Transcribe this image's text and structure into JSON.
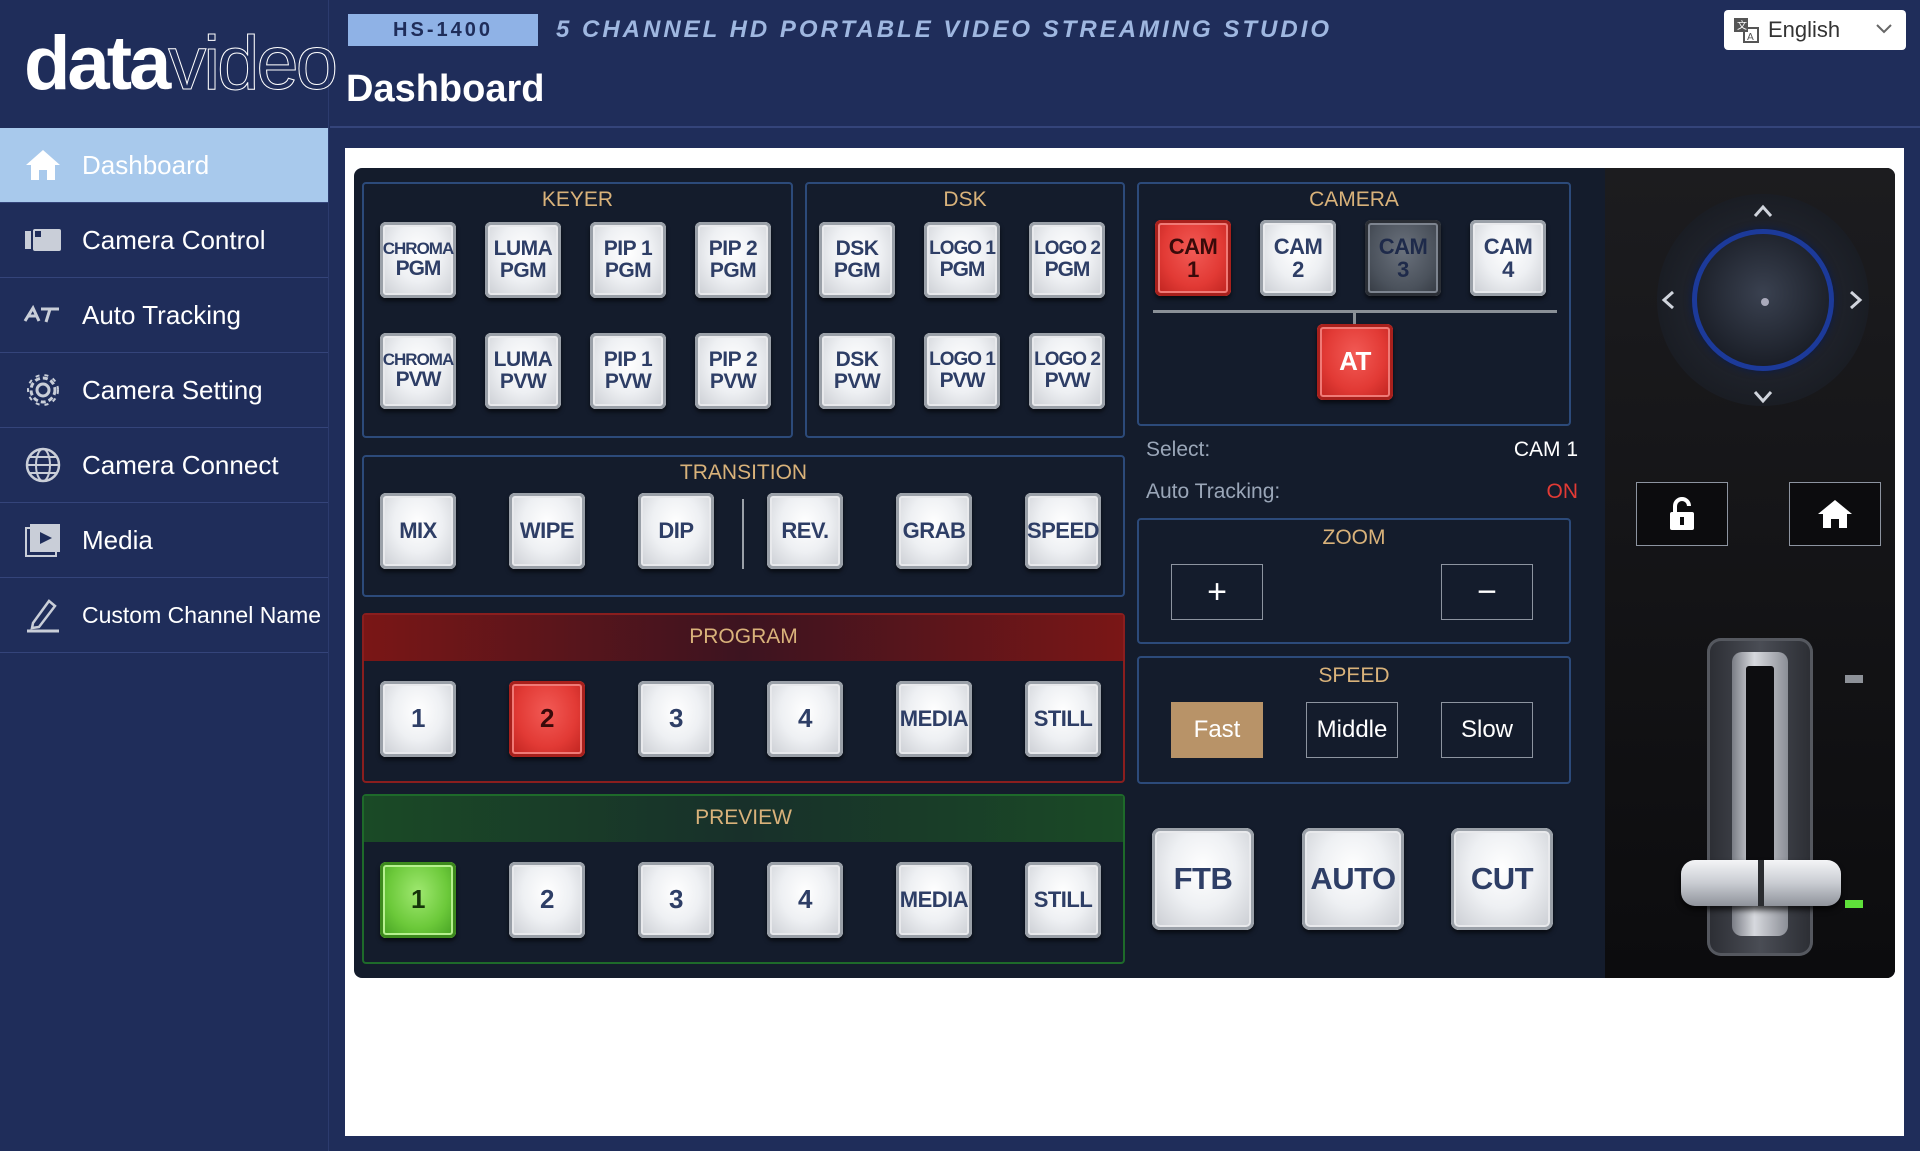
{
  "brand": {
    "logo_bold": "data",
    "logo_light": "video"
  },
  "header": {
    "model": "HS-1400",
    "subtitle": "5 CHANNEL HD PORTABLE VIDEO STREAMING STUDIO",
    "page_title": "Dashboard",
    "language": "English"
  },
  "sidebar": {
    "items": [
      {
        "label": "Dashboard",
        "icon": "home-icon",
        "active": true
      },
      {
        "label": "Camera Control",
        "icon": "camera-icon"
      },
      {
        "label": "Auto Tracking",
        "icon": "auto-tracking-icon"
      },
      {
        "label": "Camera Setting",
        "icon": "gear-icon"
      },
      {
        "label": "Camera Connect",
        "icon": "globe-icon"
      },
      {
        "label": "Media",
        "icon": "media-play-icon"
      },
      {
        "label": "Custom Channel Name",
        "icon": "pencil-icon"
      }
    ]
  },
  "keyer": {
    "title": "KEYER",
    "pgm": [
      [
        "CHROMA",
        "PGM"
      ],
      [
        "LUMA",
        "PGM"
      ],
      [
        "PIP 1",
        "PGM"
      ],
      [
        "PIP 2",
        "PGM"
      ]
    ],
    "pvw": [
      [
        "CHROMA",
        "PVW"
      ],
      [
        "LUMA",
        "PVW"
      ],
      [
        "PIP 1",
        "PVW"
      ],
      [
        "PIP 2",
        "PVW"
      ]
    ]
  },
  "dsk": {
    "title": "DSK",
    "pgm": [
      [
        "DSK",
        "PGM"
      ],
      [
        "LOGO 1",
        "PGM"
      ],
      [
        "LOGO 2",
        "PGM"
      ]
    ],
    "pvw": [
      [
        "DSK",
        "PVW"
      ],
      [
        "LOGO 1",
        "PVW"
      ],
      [
        "LOGO 2",
        "PVW"
      ]
    ]
  },
  "camera": {
    "title": "CAMERA",
    "cams": [
      [
        "CAM",
        "1"
      ],
      [
        "CAM",
        "2"
      ],
      [
        "CAM",
        "3"
      ],
      [
        "CAM",
        "4"
      ]
    ],
    "at_label": "AT",
    "select_label": "Select:",
    "select_value": "CAM 1",
    "auto_tracking_label": "Auto Tracking:",
    "auto_tracking_value": "ON"
  },
  "transition": {
    "title": "TRANSITION",
    "buttons": [
      "MIX",
      "WIPE",
      "DIP",
      "REV.",
      "GRAB",
      "SPEED"
    ]
  },
  "program": {
    "title": "PROGRAM",
    "buttons": [
      "1",
      "2",
      "3",
      "4",
      "MEDIA",
      "STILL"
    ],
    "active_index": 1
  },
  "preview": {
    "title": "PREVIEW",
    "buttons": [
      "1",
      "2",
      "3",
      "4",
      "MEDIA",
      "STILL"
    ],
    "active_index": 0
  },
  "zoom": {
    "title": "ZOOM",
    "in": "+",
    "out": "−"
  },
  "speed": {
    "title": "SPEED",
    "options": [
      "Fast",
      "Middle",
      "Slow"
    ],
    "selected": "Fast"
  },
  "actions": {
    "ftb": "FTB",
    "auto": "AUTO",
    "cut": "CUT"
  },
  "colors": {
    "accent_gold": "#d9b27a",
    "tally_red": "#e23a35",
    "tally_green": "#6cc93a",
    "nav_active": "#a8c9ec"
  }
}
